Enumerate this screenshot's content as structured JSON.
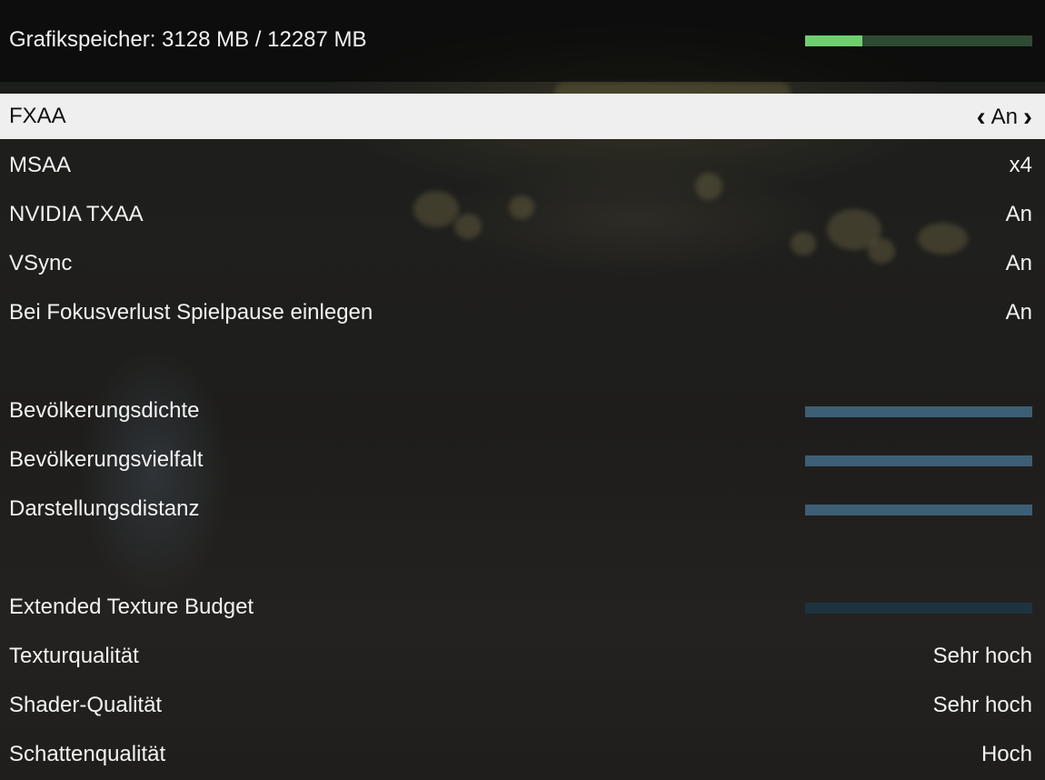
{
  "colors": {
    "vram_fill": "#6fcf70",
    "vram_track": "#2e4a33",
    "slider_fill": "#3d5f75",
    "slider_dim": "#1d3340",
    "selected_row_bg": "#efefef"
  },
  "vram": {
    "label": "Grafikspeicher: 3128 MB / 12287 MB",
    "used_fraction": 0.25
  },
  "settings": [
    {
      "label": "FXAA",
      "value": "An",
      "selected": true,
      "icons": [
        "chevron-left-icon",
        "chevron-right-icon"
      ]
    },
    {
      "label": "MSAA",
      "value": "x4"
    },
    {
      "label": "NVIDIA TXAA",
      "value": "An"
    },
    {
      "label": "VSync",
      "value": "An"
    },
    {
      "label": "Bei Fokusverlust Spielpause einlegen",
      "value": "An"
    },
    {
      "label": "Bevölkerungsdichte",
      "slider_level": 1.0
    },
    {
      "label": "Bevölkerungsvielfalt",
      "slider_level": 1.0
    },
    {
      "label": "Darstellungsdistanz",
      "slider_level": 1.0
    },
    {
      "label": "Extended Texture Budget",
      "slider_level": 1.0,
      "disabled": true
    },
    {
      "label": "Texturqualität",
      "value": "Sehr hoch"
    },
    {
      "label": "Shader-Qualität",
      "value": "Sehr hoch"
    },
    {
      "label": "Schattenqualität",
      "value": "Hoch"
    }
  ]
}
